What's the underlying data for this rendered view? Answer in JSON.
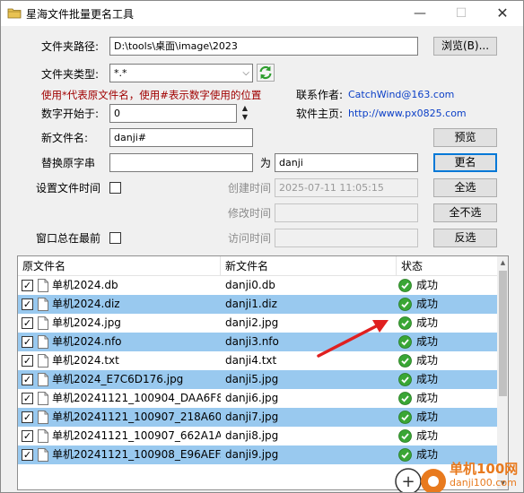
{
  "window": {
    "title": "星海文件批量更名工具",
    "min": "—",
    "max": "☐",
    "close": "✕"
  },
  "form": {
    "folder_path_label": "文件夹路径:",
    "folder_path_value": "D:\\tools\\桌面\\image\\2023",
    "browse_button": "浏览(B)...",
    "folder_type_label": "文件夹类型:",
    "folder_type_value": "*.*",
    "hint": "使用*代表原文件名，使用#表示数字使用的位置",
    "contact_label": "联系作者:",
    "contact_value": "CatchWind@163.com",
    "home_label": "软件主页:",
    "home_value": "http://www.px0825.com",
    "start_num_label": "数字开始于:",
    "start_num_value": "0",
    "new_name_label": "新文件名:",
    "new_name_value": "danji#",
    "preview_button": "预览",
    "replace_label": "替换原字串",
    "replace_from_value": "",
    "replace_as_label": "为",
    "replace_to_value": "danji",
    "rename_button": "更名",
    "set_time_label": "设置文件时间",
    "created_label": "创建时间",
    "created_value": "2025-07-11 11:05:15",
    "select_all_button": "全选",
    "modified_label": "修改时间",
    "modified_value": "",
    "select_none_button": "全不选",
    "topmost_label": "窗口总在最前",
    "accessed_label": "访问时间",
    "accessed_value": "",
    "invert_button": "反选"
  },
  "list": {
    "headers": [
      "原文件名",
      "新文件名",
      "状态"
    ],
    "rows": [
      {
        "orig": "单机2024.db",
        "new": "danji0.db",
        "status": "成功",
        "selected": false
      },
      {
        "orig": "单机2024.diz",
        "new": "danji1.diz",
        "status": "成功",
        "selected": true
      },
      {
        "orig": "单机2024.jpg",
        "new": "danji2.jpg",
        "status": "成功",
        "selected": false
      },
      {
        "orig": "单机2024.nfo",
        "new": "danji3.nfo",
        "status": "成功",
        "selected": true
      },
      {
        "orig": "单机2024.txt",
        "new": "danji4.txt",
        "status": "成功",
        "selected": false
      },
      {
        "orig": "单机2024_E7C6D176.jpg",
        "new": "danji5.jpg",
        "status": "成功",
        "selected": true
      },
      {
        "orig": "单机20241121_100904_DAA6F8...",
        "new": "danji6.jpg",
        "status": "成功",
        "selected": false
      },
      {
        "orig": "单机20241121_100907_218A60...",
        "new": "danji7.jpg",
        "status": "成功",
        "selected": true
      },
      {
        "orig": "单机20241121_100907_662A1A...",
        "new": "danji8.jpg",
        "status": "成功",
        "selected": false
      },
      {
        "orig": "单机20241121_100908_E96AEF...",
        "new": "danji9.jpg",
        "status": "成功",
        "selected": true
      }
    ]
  },
  "watermark": {
    "line1": "单机100网",
    "line2": "danji100.com"
  },
  "colors": {
    "selection": "#99c9ef",
    "hint_red": "#a00000",
    "link_blue": "#0b3fc7",
    "success_green": "#3aa635"
  }
}
